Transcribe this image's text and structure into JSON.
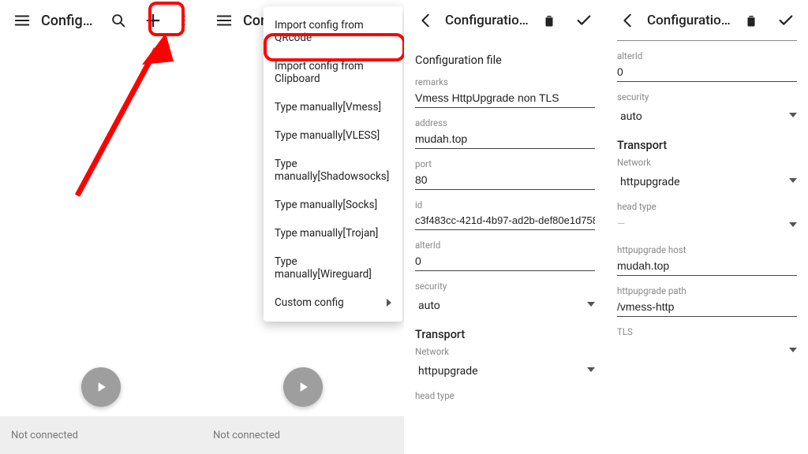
{
  "panel1": {
    "title": "Configuration…",
    "status": "Not connected"
  },
  "panel2": {
    "title": "Confi",
    "status": "Not connected",
    "menu": {
      "qrcode": "Import config from QRcode",
      "clipboard": "Import config from Clipboard",
      "vmess": "Type manually[Vmess]",
      "vless": "Type manually[VLESS]",
      "shadowsocks": "Type manually[Shadowsocks]",
      "socks": "Type manually[Socks]",
      "trojan": "Type manually[Trojan]",
      "wireguard": "Type manually[Wireguard]",
      "custom": "Custom config"
    }
  },
  "panel3": {
    "title": "Configuration file",
    "heading": "Configuration file",
    "labels": {
      "remarks": "remarks",
      "address": "address",
      "port": "port",
      "id": "id",
      "alterId": "alterId",
      "security": "security",
      "transport": "Transport",
      "network": "Network",
      "headtype": "head type"
    },
    "values": {
      "remarks": "Vmess HttpUpgrade non TLS",
      "address": "mudah.top",
      "port": "80",
      "id": "c3f483cc-421d-4b97-ad2b-def80e1d758",
      "alterId": "0",
      "security": "auto",
      "network": "httpupgrade"
    }
  },
  "panel4": {
    "title": "Configuration file",
    "labels": {
      "alterId": "alterId",
      "security": "security",
      "transport": "Transport",
      "network": "Network",
      "headtype": "head type",
      "host": "httpupgrade host",
      "path": "httpupgrade path",
      "tls": "TLS"
    },
    "values": {
      "alterId": "0",
      "security": "auto",
      "network": "httpupgrade",
      "headtype": "—",
      "host": "mudah.top",
      "path": "/vmess-http"
    }
  }
}
